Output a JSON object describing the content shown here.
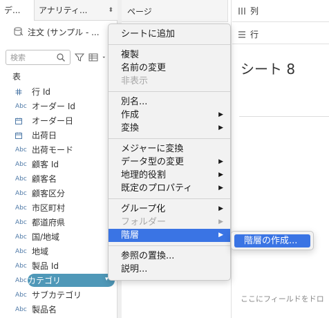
{
  "left_pane": {
    "tabs": [
      {
        "label": "デ..."
      },
      {
        "label": "アナリティ..."
      }
    ],
    "analytics_arrow": "⬍",
    "datasource": "注文 (サンプル - ...",
    "search_placeholder": "検索",
    "table_header": "表",
    "fields": [
      {
        "type": "#",
        "name": "行 Id"
      },
      {
        "type": "Abc",
        "name": "オーダー Id"
      },
      {
        "type": "cal",
        "name": "オーダー日"
      },
      {
        "type": "cal",
        "name": "出荷日"
      },
      {
        "type": "Abc",
        "name": "出荷モード"
      },
      {
        "type": "Abc",
        "name": "顧客 Id"
      },
      {
        "type": "Abc",
        "name": "顧客名"
      },
      {
        "type": "Abc",
        "name": "顧客区分"
      },
      {
        "type": "Abc",
        "name": "市区町村"
      },
      {
        "type": "Abc",
        "name": "都道府県"
      },
      {
        "type": "Abc",
        "name": "国/地域"
      },
      {
        "type": "Abc",
        "name": "地域"
      },
      {
        "type": "Abc",
        "name": "製品 Id"
      },
      {
        "type": "Abc",
        "name": "カテゴリ"
      },
      {
        "type": "Abc",
        "name": "サブカテゴリ"
      },
      {
        "type": "Abc",
        "name": "製品名"
      }
    ]
  },
  "shelves": {
    "pages": "ページ",
    "columns": "列",
    "rows": "行"
  },
  "canvas": {
    "sheet_title": "シート 8",
    "drop_hint": "ここにフィールドをドロ"
  },
  "context_menu": {
    "groups": [
      [
        {
          "label": "シートに追加",
          "arrow": false,
          "disabled": false
        }
      ],
      [
        {
          "label": "複製",
          "arrow": false,
          "disabled": false
        },
        {
          "label": "名前の変更",
          "arrow": false,
          "disabled": false
        },
        {
          "label": "非表示",
          "arrow": false,
          "disabled": true
        }
      ],
      [
        {
          "label": "別名...",
          "arrow": false,
          "disabled": false
        },
        {
          "label": "作成",
          "arrow": true,
          "disabled": false
        },
        {
          "label": "変換",
          "arrow": true,
          "disabled": false
        }
      ],
      [
        {
          "label": "メジャーに変換",
          "arrow": false,
          "disabled": false
        },
        {
          "label": "データ型の変更",
          "arrow": true,
          "disabled": false
        },
        {
          "label": "地理的役割",
          "arrow": true,
          "disabled": false
        },
        {
          "label": "既定のプロパティ",
          "arrow": true,
          "disabled": false
        }
      ],
      [
        {
          "label": "グループ化",
          "arrow": true,
          "disabled": false
        },
        {
          "label": "フォルダー",
          "arrow": true,
          "disabled": true
        },
        {
          "label": "階層",
          "arrow": true,
          "disabled": false,
          "active": true
        }
      ],
      [
        {
          "label": "参照の置換...",
          "arrow": false,
          "disabled": false
        },
        {
          "label": "説明...",
          "arrow": false,
          "disabled": false
        }
      ]
    ],
    "submenu_item": "階層の作成..."
  },
  "colors": {
    "menu_highlight": "#3a74e4",
    "selected_pill": "#4f98b8",
    "field_type": "#4e79a7"
  }
}
